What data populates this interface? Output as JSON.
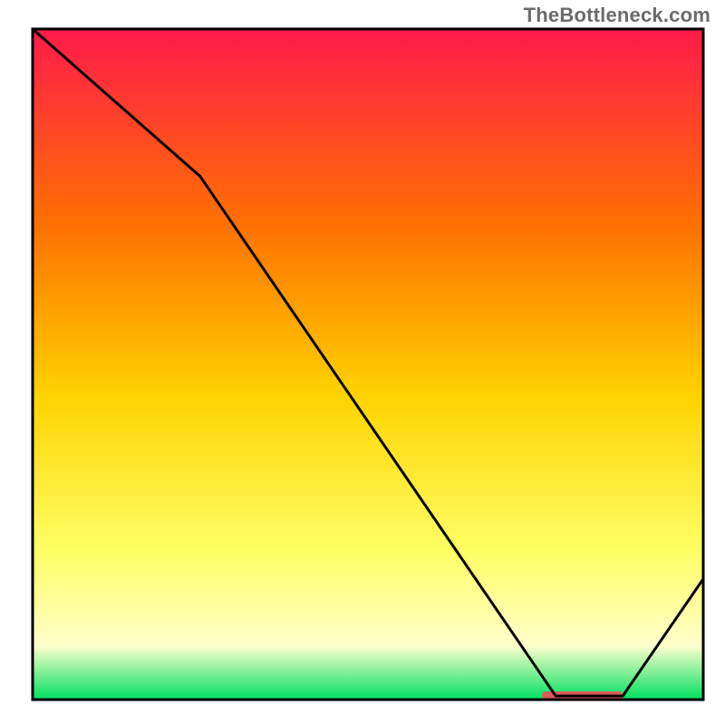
{
  "watermark": "TheBottleneck.com",
  "chart_data": {
    "type": "line",
    "title": "",
    "xlabel": "",
    "ylabel": "",
    "xlim": [
      0,
      100
    ],
    "ylim": [
      0,
      100
    ],
    "series": [
      {
        "name": "curve",
        "x": [
          0,
          25,
          78,
          88,
          100
        ],
        "values": [
          100,
          78,
          0,
          0,
          18
        ]
      }
    ],
    "plateau": {
      "x_start": 76,
      "x_end": 88,
      "y": 0
    },
    "frame": {
      "x": 4.5,
      "y": 4.0,
      "w": 92.5,
      "h": 92.5
    },
    "colors": {
      "gradient_top": "#ff1a4b",
      "gradient_mid1": "#ff7300",
      "gradient_mid2": "#ffd400",
      "gradient_mid3": "#ffff66",
      "gradient_mid4": "#ffffcc",
      "gradient_bottom": "#00e060",
      "curve": "#000000",
      "plateau_marker": "#e05a5a",
      "frame": "#000000"
    }
  }
}
